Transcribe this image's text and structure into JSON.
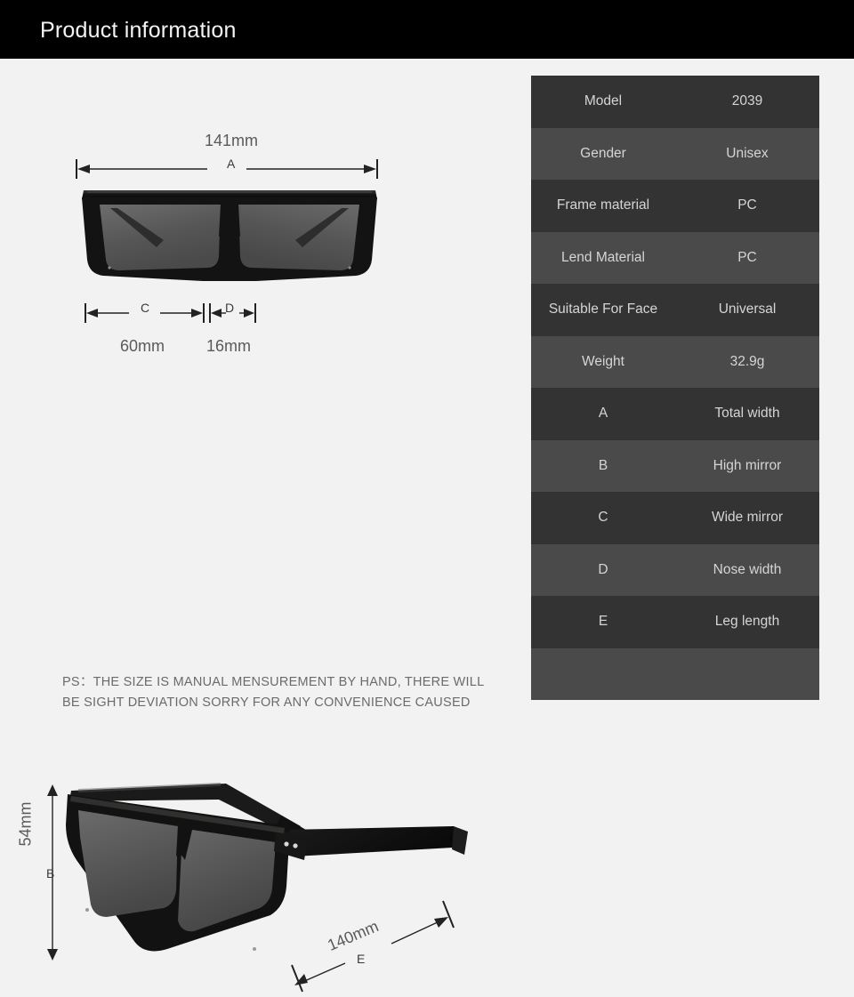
{
  "header": {
    "title": "Product information"
  },
  "front_view": {
    "total_width_label": "141mm",
    "letter_a": "A",
    "wide_mirror_label": "60mm",
    "letter_c": "C",
    "nose_width_label": "16mm",
    "letter_d": "D"
  },
  "side_view": {
    "height_label": "54mm",
    "letter_b": "B",
    "leg_length_label": "140mm",
    "letter_e": "E"
  },
  "note": {
    "line1": "PS：THE SIZE IS MANUAL MENSUREMENT BY HAND, THERE WILL",
    "line2": "BE SIGHT DEVIATION SORRY FOR ANY CONVENIENCE CAUSED"
  },
  "spec_table": {
    "rows": [
      {
        "key": "Model",
        "value": "2039"
      },
      {
        "key": "Gender",
        "value": "Unisex"
      },
      {
        "key": "Frame material",
        "value": "PC"
      },
      {
        "key": "Lend Material",
        "value": "PC"
      },
      {
        "key": "Suitable For Face",
        "value": "Universal"
      },
      {
        "key": "Weight",
        "value": "32.9g"
      },
      {
        "key": "A",
        "value": "Total width"
      },
      {
        "key": "B",
        "value": "High mirror"
      },
      {
        "key": "C",
        "value": "Wide mirror"
      },
      {
        "key": "D",
        "value": "Nose width"
      },
      {
        "key": "E",
        "value": "Leg length"
      },
      {
        "key": "",
        "value": ""
      }
    ]
  },
  "colors": {
    "header_bg": "#000000",
    "page_bg": "#f2f2f2",
    "row_dark": "#333333",
    "row_light": "#4a4a4a",
    "table_text": "#d5d5d5",
    "dim_text": "#5a5a5a",
    "note_text": "#6b6b6b"
  }
}
